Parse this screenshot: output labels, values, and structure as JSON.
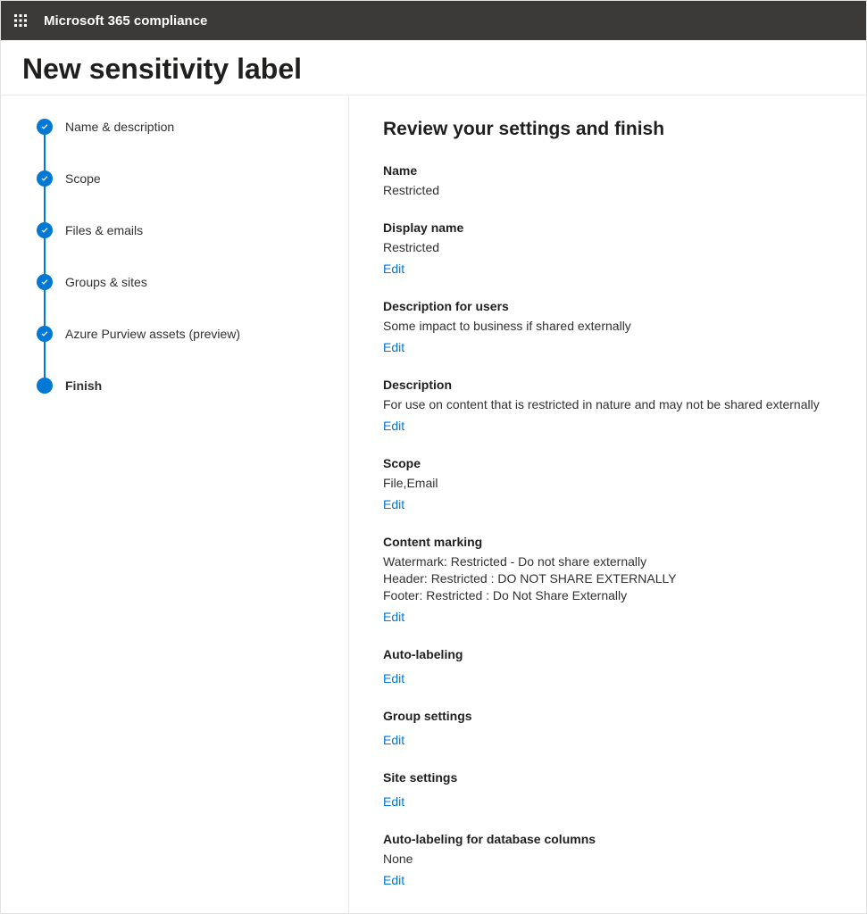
{
  "header": {
    "app_title": "Microsoft 365 compliance"
  },
  "page": {
    "title": "New sensitivity label"
  },
  "wizard": {
    "steps": [
      {
        "label": "Name & description",
        "state": "completed"
      },
      {
        "label": "Scope",
        "state": "completed"
      },
      {
        "label": "Files & emails",
        "state": "completed"
      },
      {
        "label": "Groups & sites",
        "state": "completed"
      },
      {
        "label": "Azure Purview assets (preview)",
        "state": "completed"
      },
      {
        "label": "Finish",
        "state": "current"
      }
    ]
  },
  "content": {
    "title": "Review your settings and finish",
    "edit_label": "Edit",
    "sections": {
      "name": {
        "label": "Name",
        "value": "Restricted"
      },
      "display_name": {
        "label": "Display name",
        "value": "Restricted"
      },
      "description_users": {
        "label": "Description for users",
        "value": "Some impact to business if shared externally"
      },
      "description": {
        "label": "Description",
        "value": "For use on content that is restricted in nature and may not be shared externally"
      },
      "scope": {
        "label": "Scope",
        "value": "File,Email"
      },
      "content_marking": {
        "label": "Content marking",
        "lines": [
          "Watermark: Restricted - Do not share externally",
          "Header: Restricted : DO NOT SHARE EXTERNALLY",
          "Footer: Restricted : Do Not Share Externally"
        ]
      },
      "auto_labeling": {
        "label": "Auto-labeling"
      },
      "group_settings": {
        "label": "Group settings"
      },
      "site_settings": {
        "label": "Site settings"
      },
      "auto_labeling_db": {
        "label": "Auto-labeling for database columns",
        "value": "None"
      }
    }
  }
}
